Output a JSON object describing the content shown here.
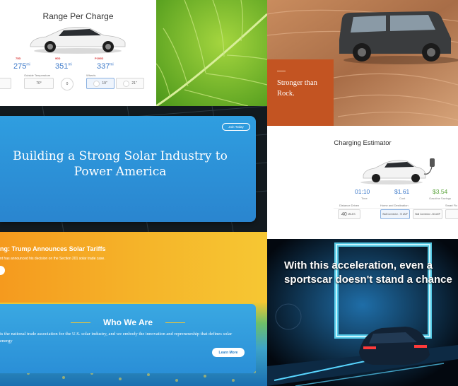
{
  "tesla": {
    "title": "Range Per Charge",
    "models": [
      {
        "name": "75D",
        "value": "275",
        "unit": "mi"
      },
      {
        "name": "90D",
        "value": "351",
        "unit": "mi"
      },
      {
        "name": "P100D",
        "value": "337",
        "unit": "mi"
      }
    ],
    "temp_label": "Outside Temperature",
    "temp_value": "70°",
    "wheels_label": "Wheels",
    "wheels": [
      "19\"",
      "21\""
    ],
    "speed_value": "0"
  },
  "gclass": {
    "tagline": "Stronger than Rock."
  },
  "solar": {
    "join_label": "Join Today",
    "headline": "Building a Strong Solar Industry to Power America"
  },
  "tariff": {
    "headline": "ng: Trump Announces Solar Tariffs",
    "subtext": "nt has announced his decision on the Section 201 solar trade case."
  },
  "who": {
    "title": "Who We Are",
    "body": "is the national trade association for the U.S. solar industry, and we embody the innovation and repreneurship that defines solar energy",
    "button": "Learn More"
  },
  "charging": {
    "title": "Charging Estimator",
    "stats": [
      {
        "value": "01:10",
        "label": "Time",
        "color": "#3b78c9"
      },
      {
        "value": "$1.61",
        "label": "Cost",
        "color": "#3b78c9"
      },
      {
        "value": "$3.54",
        "label": "Gasoline Savings",
        "color": "#59a33a"
      }
    ],
    "distance_label": "Distance Driven",
    "distance_value": "40",
    "distance_unit": "MILES",
    "home_label": "Home and Destination",
    "connectors": [
      "Wall Connector - 70 AMP",
      "Wall Connector - 80 AMP"
    ],
    "small_label": "Smart Fix"
  },
  "accel": {
    "headline": "With this acceleration, even a sportscar doesn't stand a chance"
  }
}
